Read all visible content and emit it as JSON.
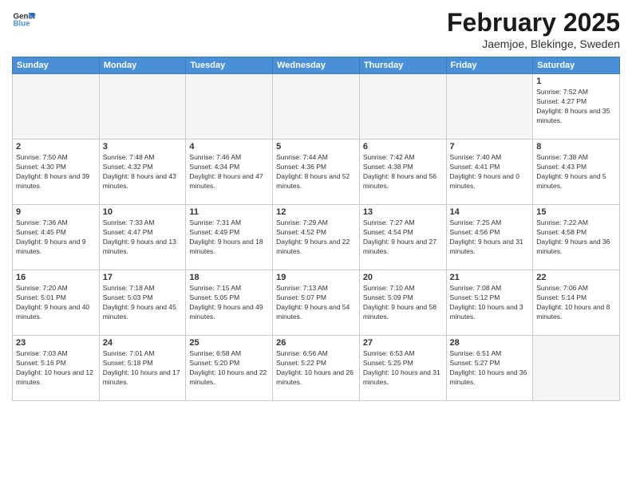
{
  "logo": {
    "line1": "General",
    "line2": "Blue"
  },
  "header": {
    "month": "February 2025",
    "location": "Jaemjoe, Blekinge, Sweden"
  },
  "weekdays": [
    "Sunday",
    "Monday",
    "Tuesday",
    "Wednesday",
    "Thursday",
    "Friday",
    "Saturday"
  ],
  "weeks": [
    [
      {
        "day": "",
        "info": ""
      },
      {
        "day": "",
        "info": ""
      },
      {
        "day": "",
        "info": ""
      },
      {
        "day": "",
        "info": ""
      },
      {
        "day": "",
        "info": ""
      },
      {
        "day": "",
        "info": ""
      },
      {
        "day": "1",
        "info": "Sunrise: 7:52 AM\nSunset: 4:27 PM\nDaylight: 8 hours and 35 minutes."
      }
    ],
    [
      {
        "day": "2",
        "info": "Sunrise: 7:50 AM\nSunset: 4:30 PM\nDaylight: 8 hours and 39 minutes."
      },
      {
        "day": "3",
        "info": "Sunrise: 7:48 AM\nSunset: 4:32 PM\nDaylight: 8 hours and 43 minutes."
      },
      {
        "day": "4",
        "info": "Sunrise: 7:46 AM\nSunset: 4:34 PM\nDaylight: 8 hours and 47 minutes."
      },
      {
        "day": "5",
        "info": "Sunrise: 7:44 AM\nSunset: 4:36 PM\nDaylight: 8 hours and 52 minutes."
      },
      {
        "day": "6",
        "info": "Sunrise: 7:42 AM\nSunset: 4:38 PM\nDaylight: 8 hours and 56 minutes."
      },
      {
        "day": "7",
        "info": "Sunrise: 7:40 AM\nSunset: 4:41 PM\nDaylight: 9 hours and 0 minutes."
      },
      {
        "day": "8",
        "info": "Sunrise: 7:38 AM\nSunset: 4:43 PM\nDaylight: 9 hours and 5 minutes."
      }
    ],
    [
      {
        "day": "9",
        "info": "Sunrise: 7:36 AM\nSunset: 4:45 PM\nDaylight: 9 hours and 9 minutes."
      },
      {
        "day": "10",
        "info": "Sunrise: 7:33 AM\nSunset: 4:47 PM\nDaylight: 9 hours and 13 minutes."
      },
      {
        "day": "11",
        "info": "Sunrise: 7:31 AM\nSunset: 4:49 PM\nDaylight: 9 hours and 18 minutes."
      },
      {
        "day": "12",
        "info": "Sunrise: 7:29 AM\nSunset: 4:52 PM\nDaylight: 9 hours and 22 minutes."
      },
      {
        "day": "13",
        "info": "Sunrise: 7:27 AM\nSunset: 4:54 PM\nDaylight: 9 hours and 27 minutes."
      },
      {
        "day": "14",
        "info": "Sunrise: 7:25 AM\nSunset: 4:56 PM\nDaylight: 9 hours and 31 minutes."
      },
      {
        "day": "15",
        "info": "Sunrise: 7:22 AM\nSunset: 4:58 PM\nDaylight: 9 hours and 36 minutes."
      }
    ],
    [
      {
        "day": "16",
        "info": "Sunrise: 7:20 AM\nSunset: 5:01 PM\nDaylight: 9 hours and 40 minutes."
      },
      {
        "day": "17",
        "info": "Sunrise: 7:18 AM\nSunset: 5:03 PM\nDaylight: 9 hours and 45 minutes."
      },
      {
        "day": "18",
        "info": "Sunrise: 7:15 AM\nSunset: 5:05 PM\nDaylight: 9 hours and 49 minutes."
      },
      {
        "day": "19",
        "info": "Sunrise: 7:13 AM\nSunset: 5:07 PM\nDaylight: 9 hours and 54 minutes."
      },
      {
        "day": "20",
        "info": "Sunrise: 7:10 AM\nSunset: 5:09 PM\nDaylight: 9 hours and 58 minutes."
      },
      {
        "day": "21",
        "info": "Sunrise: 7:08 AM\nSunset: 5:12 PM\nDaylight: 10 hours and 3 minutes."
      },
      {
        "day": "22",
        "info": "Sunrise: 7:06 AM\nSunset: 5:14 PM\nDaylight: 10 hours and 8 minutes."
      }
    ],
    [
      {
        "day": "23",
        "info": "Sunrise: 7:03 AM\nSunset: 5:16 PM\nDaylight: 10 hours and 12 minutes."
      },
      {
        "day": "24",
        "info": "Sunrise: 7:01 AM\nSunset: 5:18 PM\nDaylight: 10 hours and 17 minutes."
      },
      {
        "day": "25",
        "info": "Sunrise: 6:58 AM\nSunset: 5:20 PM\nDaylight: 10 hours and 22 minutes."
      },
      {
        "day": "26",
        "info": "Sunrise: 6:56 AM\nSunset: 5:22 PM\nDaylight: 10 hours and 26 minutes."
      },
      {
        "day": "27",
        "info": "Sunrise: 6:53 AM\nSunset: 5:25 PM\nDaylight: 10 hours and 31 minutes."
      },
      {
        "day": "28",
        "info": "Sunrise: 6:51 AM\nSunset: 5:27 PM\nDaylight: 10 hours and 36 minutes."
      },
      {
        "day": "",
        "info": ""
      }
    ]
  ]
}
